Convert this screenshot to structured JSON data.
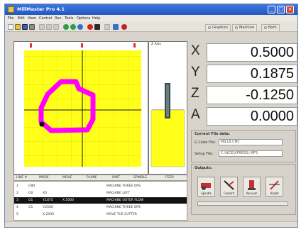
{
  "window": {
    "title": "MillMaster Pro 4.1"
  },
  "menu": [
    "File",
    "Edit",
    "View",
    "Control",
    "Run",
    "Tools",
    "Options",
    "Help"
  ],
  "tabs": [
    "Graphics",
    "Machine",
    "Both"
  ],
  "zview_label": "Z Axis",
  "dro": [
    {
      "axis": "X",
      "value": "0.5000"
    },
    {
      "axis": "Y",
      "value": "0.1875"
    },
    {
      "axis": "Z",
      "value": "-0.1250"
    },
    {
      "axis": "A",
      "value": "0.0000"
    }
  ],
  "current_files": {
    "title": "Current File data:",
    "gcode_label": "G Code File:",
    "gcode_value": "MILL8.CNC",
    "setup_label": "Setup File:",
    "setup_value": "C:\\NCE\\XPRESS\\.MFS"
  },
  "outputs": {
    "title": "Outputs:",
    "buttons": [
      "Spindle",
      "Coolant",
      "Vacuum",
      "Air/Jet"
    ]
  },
  "gcode_headers": [
    "LINE #",
    "MODE",
    "MOVE",
    "PLANE",
    "UNIT",
    "SPINDLE",
    "FEED"
  ],
  "gcode_lines": [
    {
      "cols": [
        "1",
        "G90",
        "",
        "",
        "MACHINE THREE OPS",
        ""
      ]
    },
    {
      "cols": [
        "2",
        "G0",
        "X0",
        "",
        "MACHINE LEFT",
        ""
      ]
    },
    {
      "cols": [
        "3",
        "G1",
        "Y.1875",
        "X.5000",
        "MACHINE OUTER FLOW",
        ""
      ],
      "selected": true
    },
    {
      "cols": [
        "4",
        "G1",
        "Y.2500",
        "",
        "MACHINE THREE OPS",
        ""
      ]
    },
    {
      "cols": [
        "5",
        "",
        "X.2000",
        "",
        "MOVE THE CUTTER",
        ""
      ]
    }
  ],
  "colors": {
    "plot_fill": "#ffff1a",
    "toolpath": "#ff00ff",
    "title_bar": "#2f6bd1",
    "axis_line": "#111111"
  }
}
